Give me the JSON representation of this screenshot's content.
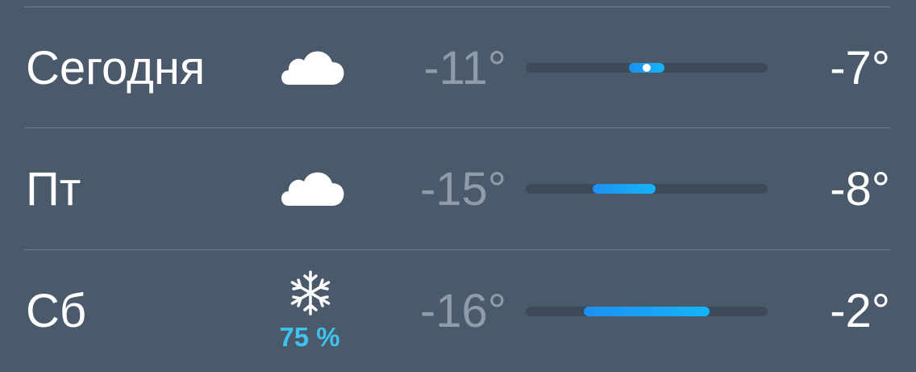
{
  "colors": {
    "background": "#4a5a6b",
    "divider": "rgba(255,255,255,0.22)",
    "track": "#3c4a59",
    "low_temp": "#8f9ba8",
    "high_temp": "#ffffff",
    "precip": "#3fc2ee",
    "bar_start": "#1e90f0",
    "bar_end": "#14b4f7"
  },
  "forecast": {
    "range_min": -16,
    "range_max": -2,
    "days": [
      {
        "label": "Сегодня",
        "icon": "cloud-icon",
        "precip": "",
        "low": "-11°",
        "high": "-7°",
        "low_value": -11,
        "high_value": -7,
        "current_value": -7
      },
      {
        "label": "Пт",
        "icon": "cloud-icon",
        "precip": "",
        "low": "-15°",
        "high": "-8°",
        "low_value": -15,
        "high_value": -8,
        "current_value": null
      },
      {
        "label": "Сб",
        "icon": "snowflake-icon",
        "precip": "75 %",
        "low": "-16°",
        "high": "-2°",
        "low_value": -16,
        "high_value": -2,
        "current_value": null
      }
    ]
  }
}
